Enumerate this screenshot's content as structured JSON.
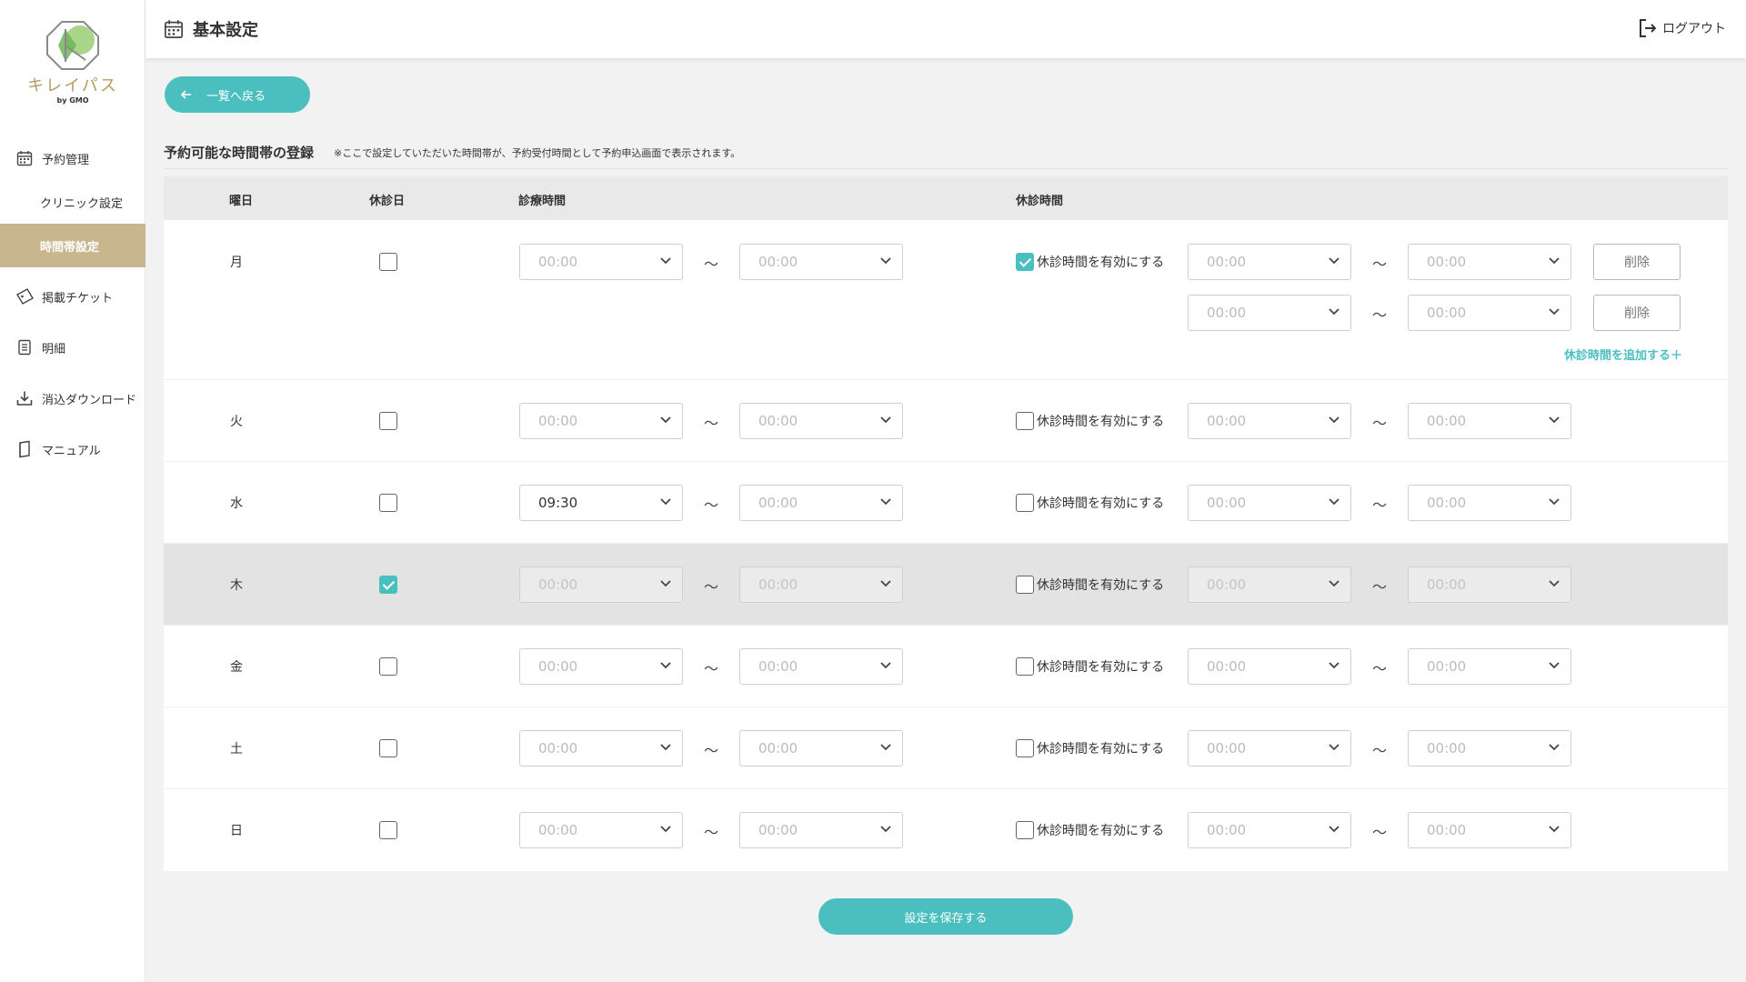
{
  "brand": {
    "name": "キレイパス",
    "sub": "by GMO",
    "color": "#b59b63"
  },
  "colors": {
    "accent": "#4bbfbf",
    "active_nav": "#c8b68f"
  },
  "sidebar": {
    "items": [
      {
        "label": "予約管理",
        "icon": "calendar-icon"
      },
      {
        "label": "クリニック設定"
      },
      {
        "label": "時間帯設定",
        "active": true
      },
      {
        "label": "掲載チケット",
        "icon": "ticket-icon"
      },
      {
        "label": "明細",
        "icon": "document-icon"
      },
      {
        "label": "消込ダウンロード",
        "icon": "download-icon"
      },
      {
        "label": "マニュアル",
        "icon": "manual-icon"
      }
    ]
  },
  "header": {
    "title": "基本設定",
    "logout": "ログアウト"
  },
  "main": {
    "back_label": "一覧へ戻る",
    "section_title": "予約可能な時間帯の登録",
    "section_note": "※ここで設定していただいた時間帯が、予約受付時間として予約申込画面で表示されます。",
    "columns": {
      "day": "曜日",
      "holiday": "休診日",
      "hours": "診療時間",
      "break": "休診時間"
    },
    "tilde": "〜",
    "break_enable_label": "休診時間を有効にする",
    "delete_label": "削除",
    "add_break_label": "休診時間を追加する＋",
    "save_label": "設定を保存する",
    "days": [
      {
        "day": "月",
        "holiday": false,
        "start": "00:00",
        "end": "00:00",
        "break_enabled": true,
        "breaks": [
          {
            "start": "00:00",
            "end": "00:00"
          },
          {
            "start": "00:00",
            "end": "00:00"
          }
        ]
      },
      {
        "day": "火",
        "holiday": false,
        "start": "00:00",
        "end": "00:00",
        "break_enabled": false,
        "break_start": "00:00",
        "break_end": "00:00"
      },
      {
        "day": "水",
        "holiday": false,
        "start": "09:30",
        "end": "00:00",
        "break_enabled": false,
        "break_start": "00:00",
        "break_end": "00:00"
      },
      {
        "day": "木",
        "holiday": true,
        "start": "00:00",
        "end": "00:00",
        "break_enabled": false,
        "break_start": "00:00",
        "break_end": "00:00"
      },
      {
        "day": "金",
        "holiday": false,
        "start": "00:00",
        "end": "00:00",
        "break_enabled": false,
        "break_start": "00:00",
        "break_end": "00:00"
      },
      {
        "day": "土",
        "holiday": false,
        "start": "00:00",
        "end": "00:00",
        "break_enabled": false,
        "break_start": "00:00",
        "break_end": "00:00"
      },
      {
        "day": "日",
        "holiday": false,
        "start": "00:00",
        "end": "00:00",
        "break_enabled": false,
        "break_start": "00:00",
        "break_end": "00:00"
      }
    ]
  }
}
